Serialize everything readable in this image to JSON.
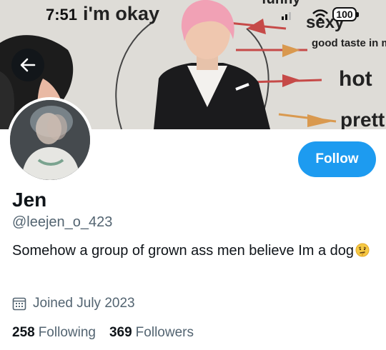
{
  "status_bar": {
    "time": "7:51",
    "battery": "100"
  },
  "banner": {
    "words": {
      "okay": "i'm okay",
      "funny": "funny",
      "sexy": "sexy",
      "good_taste": "good taste in music",
      "hot": "hot",
      "pretty": "prett"
    }
  },
  "profile": {
    "display_name": "Jen",
    "handle": "@leejen_o_423",
    "bio": "Somehow a group of grown ass men believe Im a dog",
    "joined": "Joined July 2023",
    "following_count": "258",
    "following_label": "Following",
    "followers_count": "369",
    "followers_label": "Followers"
  },
  "actions": {
    "follow_label": "Follow"
  },
  "icons": {
    "back": "back-arrow-icon",
    "calendar": "calendar-icon",
    "emoji": "thinking-face-emoji-icon"
  },
  "colors": {
    "accent": "#1d9bf0",
    "secondary_text": "#536471",
    "primary_text": "#0f1419"
  }
}
